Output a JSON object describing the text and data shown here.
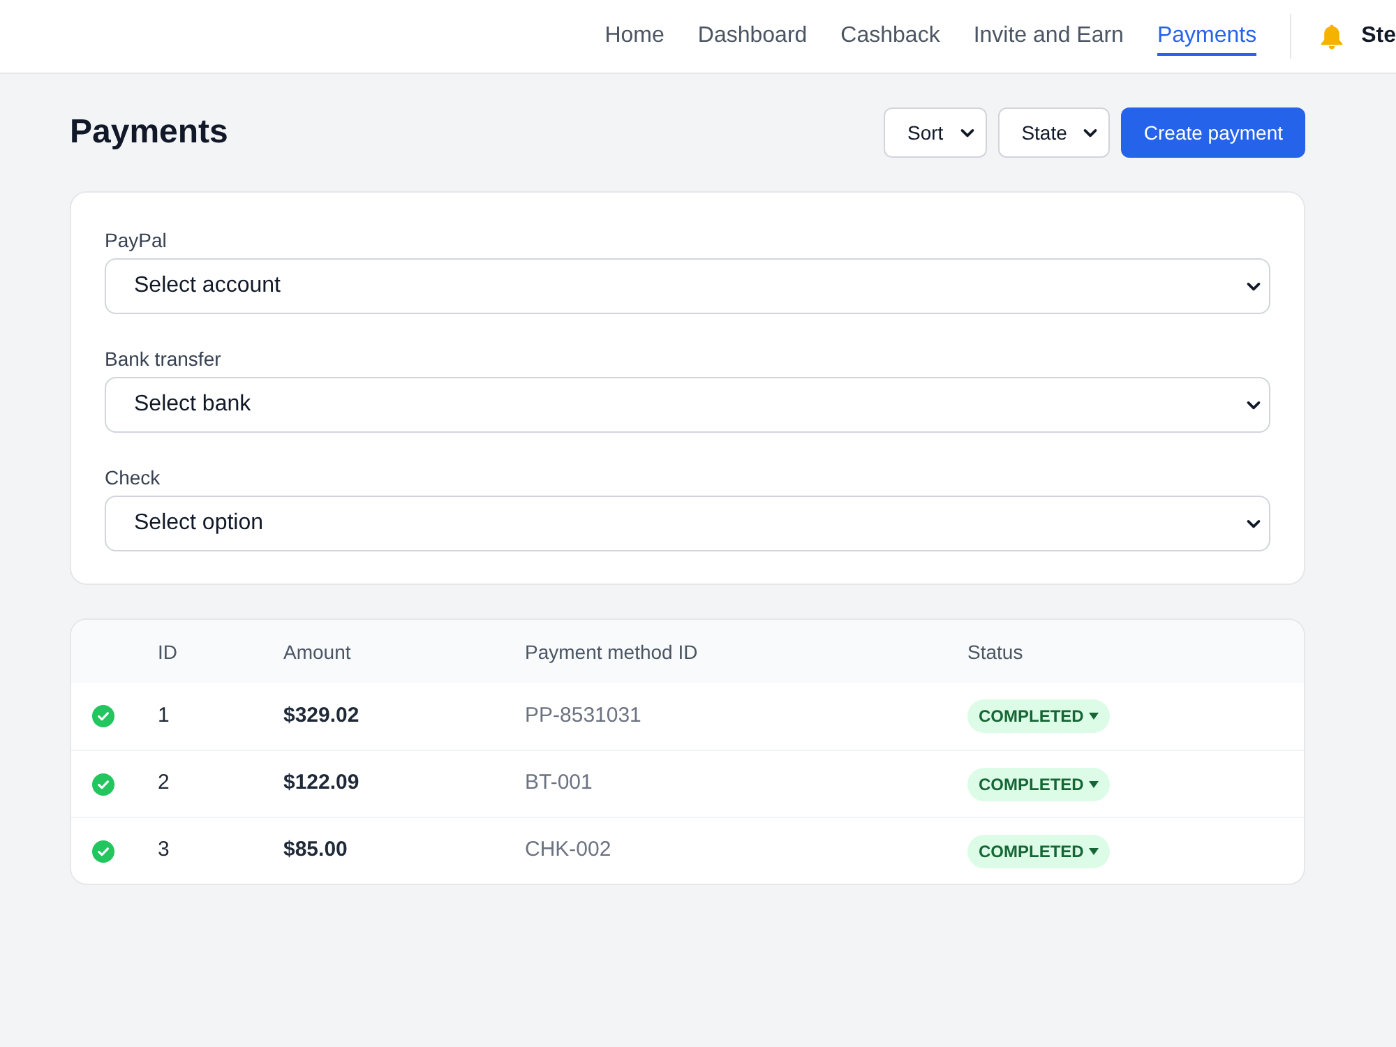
{
  "nav": {
    "items": [
      {
        "label": "Home",
        "selected": false
      },
      {
        "label": "Dashboard",
        "selected": false
      },
      {
        "label": "Cashback",
        "selected": false
      },
      {
        "label": "Invite and Earn",
        "selected": false
      },
      {
        "label": "Payments",
        "selected": true
      }
    ],
    "user": "Ste"
  },
  "page": {
    "title": "Payments",
    "filters": [
      {
        "label": "Sort"
      },
      {
        "label": "State"
      }
    ],
    "primary_button": "Create payment"
  },
  "payment_methods": [
    {
      "label": "PayPal",
      "placeholder": "Select account"
    },
    {
      "label": "Bank transfer",
      "placeholder": "Select bank"
    },
    {
      "label": "Check",
      "placeholder": "Select option"
    }
  ],
  "table": {
    "columns": [
      "ID",
      "Amount",
      "Payment method ID",
      "Status"
    ],
    "rows": [
      {
        "id": "1",
        "amount": "$329.02",
        "method_id": "PP-8531031",
        "status": "COMPLETED"
      },
      {
        "id": "2",
        "amount": "$122.09",
        "method_id": "BT-001",
        "status": "COMPLETED"
      },
      {
        "id": "3",
        "amount": "$85.00",
        "method_id": "CHK-002",
        "status": "COMPLETED"
      }
    ]
  }
}
